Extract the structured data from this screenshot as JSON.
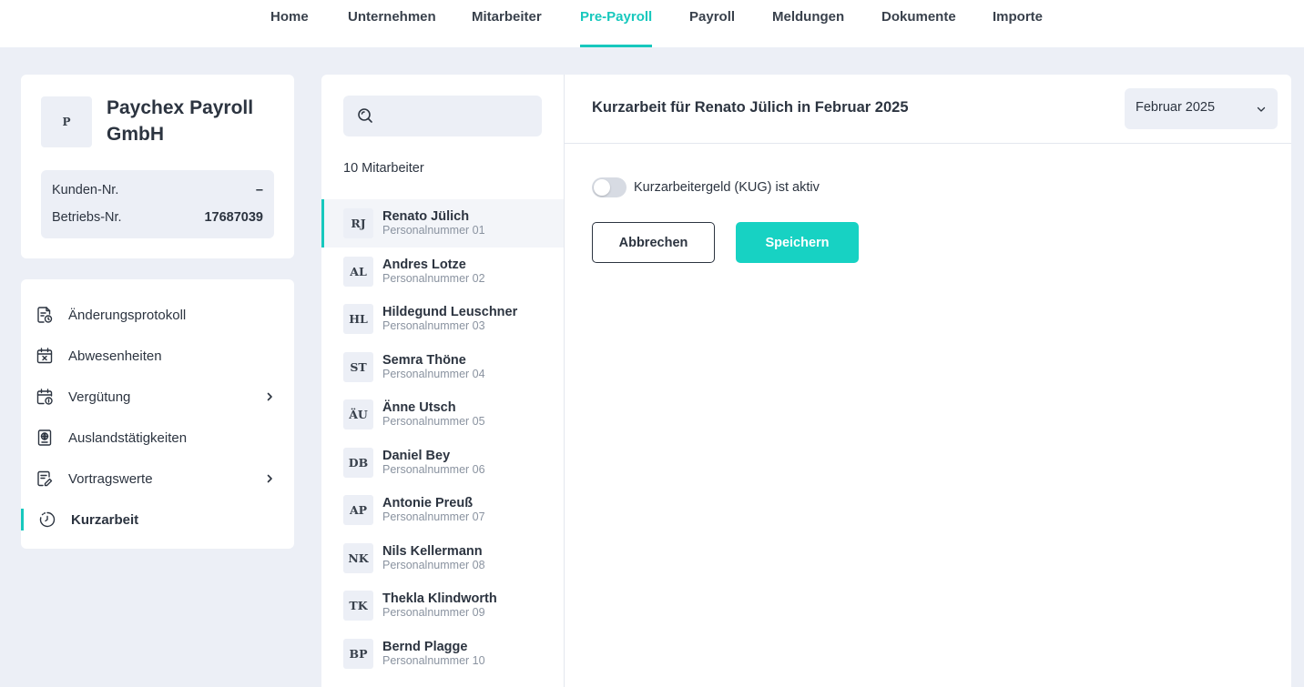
{
  "nav": {
    "items": [
      {
        "label": "Home"
      },
      {
        "label": "Unternehmen"
      },
      {
        "label": "Mitarbeiter"
      },
      {
        "label": "Pre-Payroll",
        "active": true
      },
      {
        "label": "Payroll"
      },
      {
        "label": "Meldungen"
      },
      {
        "label": "Dokumente"
      },
      {
        "label": "Importe"
      }
    ]
  },
  "company": {
    "logo_initial": "P",
    "name": "Paychex Payroll GmbH",
    "customer_no_label": "Kunden-Nr.",
    "customer_no_value": "–",
    "business_no_label": "Betriebs-Nr.",
    "business_no_value": "17687039"
  },
  "menu": {
    "items": [
      {
        "label": "Änderungsprotokoll",
        "icon": "document-clock-icon"
      },
      {
        "label": "Abwesenheiten",
        "icon": "calendar-x-icon"
      },
      {
        "label": "Vergütung",
        "icon": "calendar-money-icon",
        "has_submenu": true
      },
      {
        "label": "Auslandstätigkeiten",
        "icon": "passport-icon"
      },
      {
        "label": "Vortragswerte",
        "icon": "document-edit-icon",
        "has_submenu": true
      },
      {
        "label": "Kurzarbeit",
        "icon": "timer-icon",
        "active": true
      }
    ]
  },
  "employees": {
    "search_value": "",
    "count_label": "10 Mitarbeiter",
    "items": [
      {
        "initials": "RJ",
        "name": "Renato Jülich",
        "sub": "Personalnummer 01",
        "selected": true
      },
      {
        "initials": "AL",
        "name": "Andres Lotze",
        "sub": "Personalnummer 02"
      },
      {
        "initials": "HL",
        "name": "Hildegund Leuschner",
        "sub": "Personalnummer 03"
      },
      {
        "initials": "ST",
        "name": "Semra Thöne",
        "sub": "Personalnummer 04"
      },
      {
        "initials": "ÄU",
        "name": "Änne Utsch",
        "sub": "Personalnummer 05"
      },
      {
        "initials": "DB",
        "name": "Daniel Bey",
        "sub": "Personalnummer 06"
      },
      {
        "initials": "AP",
        "name": "Antonie Preuß",
        "sub": "Personalnummer 07"
      },
      {
        "initials": "NK",
        "name": "Nils Kellermann",
        "sub": "Personalnummer 08"
      },
      {
        "initials": "TK",
        "name": "Thekla Klindworth",
        "sub": "Personalnummer 09"
      },
      {
        "initials": "BP",
        "name": "Bernd Plagge",
        "sub": "Personalnummer 10"
      }
    ]
  },
  "main": {
    "title": "Kurzarbeit für Renato Jülich in Februar 2025",
    "month_value": "Februar 2025",
    "toggle_label": "Kurzarbeitergeld (KUG) ist aktiv",
    "toggle_on": false,
    "cancel_label": "Abbrechen",
    "save_label": "Speichern"
  },
  "colors": {
    "accent": "#17c8bd",
    "save_button": "#17d2c3",
    "background": "#eceff6",
    "text": "#2c3440",
    "muted": "#8a93a0"
  }
}
